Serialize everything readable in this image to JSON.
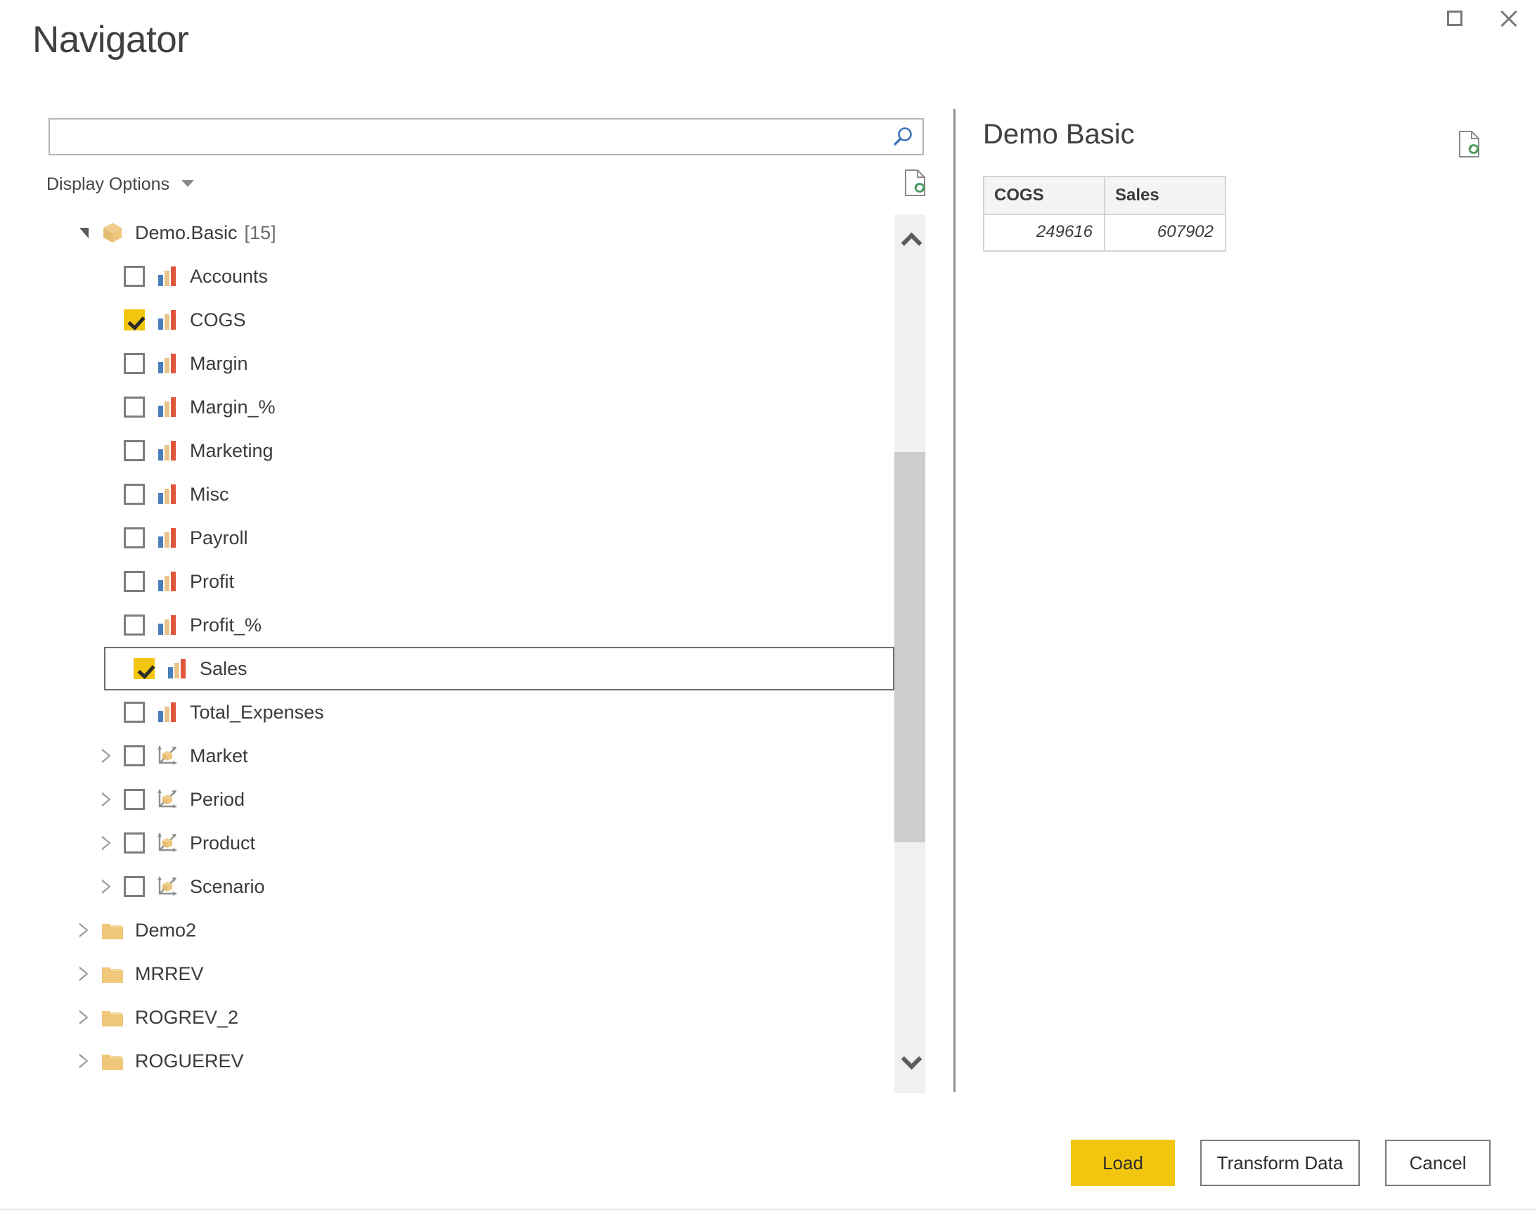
{
  "window": {
    "title": "Navigator",
    "controls": [
      {
        "name": "maximize",
        "icon": "maximize-icon"
      },
      {
        "name": "close",
        "icon": "close-icon"
      }
    ]
  },
  "search": {
    "value": "",
    "placeholder": "",
    "icon": "search-icon"
  },
  "toolbar": {
    "display_options_label": "Display Options",
    "refresh_icon": "refresh-preview-icon"
  },
  "tree": {
    "items": [
      {
        "label": "Demo.Basic",
        "count": "[15]",
        "icon": "cube-icon",
        "indent": 0,
        "expander": "expanded",
        "checkbox": "none",
        "selected": false
      },
      {
        "label": "Accounts",
        "count": "",
        "icon": "measure-bars-icon",
        "indent": 1,
        "expander": "none",
        "checkbox": "unchecked",
        "selected": false
      },
      {
        "label": "COGS",
        "count": "",
        "icon": "measure-bars-icon",
        "indent": 1,
        "expander": "none",
        "checkbox": "checked",
        "selected": false
      },
      {
        "label": "Margin",
        "count": "",
        "icon": "measure-bars-icon",
        "indent": 1,
        "expander": "none",
        "checkbox": "unchecked",
        "selected": false
      },
      {
        "label": "Margin_%",
        "count": "",
        "icon": "measure-bars-icon",
        "indent": 1,
        "expander": "none",
        "checkbox": "unchecked",
        "selected": false
      },
      {
        "label": "Marketing",
        "count": "",
        "icon": "measure-bars-icon",
        "indent": 1,
        "expander": "none",
        "checkbox": "unchecked",
        "selected": false
      },
      {
        "label": "Misc",
        "count": "",
        "icon": "measure-bars-icon",
        "indent": 1,
        "expander": "none",
        "checkbox": "unchecked",
        "selected": false
      },
      {
        "label": "Payroll",
        "count": "",
        "icon": "measure-bars-icon",
        "indent": 1,
        "expander": "none",
        "checkbox": "unchecked",
        "selected": false
      },
      {
        "label": "Profit",
        "count": "",
        "icon": "measure-bars-icon",
        "indent": 1,
        "expander": "none",
        "checkbox": "unchecked",
        "selected": false
      },
      {
        "label": "Profit_%",
        "count": "",
        "icon": "measure-bars-icon",
        "indent": 1,
        "expander": "none",
        "checkbox": "unchecked",
        "selected": false
      },
      {
        "label": "Sales",
        "count": "",
        "icon": "measure-bars-icon",
        "indent": 1,
        "expander": "none",
        "checkbox": "checked",
        "selected": true
      },
      {
        "label": "Total_Expenses",
        "count": "",
        "icon": "measure-bars-icon",
        "indent": 1,
        "expander": "none",
        "checkbox": "unchecked",
        "selected": false
      },
      {
        "label": "Market",
        "count": "",
        "icon": "dimension-axes-icon",
        "indent": 1,
        "expander": "collapsed",
        "checkbox": "unchecked",
        "selected": false
      },
      {
        "label": "Period",
        "count": "",
        "icon": "dimension-axes-icon",
        "indent": 1,
        "expander": "collapsed",
        "checkbox": "unchecked",
        "selected": false
      },
      {
        "label": "Product",
        "count": "",
        "icon": "dimension-axes-icon",
        "indent": 1,
        "expander": "collapsed",
        "checkbox": "unchecked",
        "selected": false
      },
      {
        "label": "Scenario",
        "count": "",
        "icon": "dimension-axes-icon",
        "indent": 1,
        "expander": "collapsed",
        "checkbox": "unchecked",
        "selected": false
      },
      {
        "label": "Demo2",
        "count": "",
        "icon": "folder-icon",
        "indent": 0,
        "expander": "collapsed",
        "checkbox": "none",
        "selected": false
      },
      {
        "label": "MRREV",
        "count": "",
        "icon": "folder-icon",
        "indent": 0,
        "expander": "collapsed",
        "checkbox": "none",
        "selected": false
      },
      {
        "label": "ROGREV_2",
        "count": "",
        "icon": "folder-icon",
        "indent": 0,
        "expander": "collapsed",
        "checkbox": "none",
        "selected": false
      },
      {
        "label": "ROGUEREV",
        "count": "",
        "icon": "folder-icon",
        "indent": 0,
        "expander": "collapsed",
        "checkbox": "none",
        "selected": false
      }
    ]
  },
  "scrollbar": {
    "up_icon": "chevron-up-icon",
    "down_icon": "chevron-down-icon"
  },
  "preview": {
    "title": "Demo Basic",
    "refresh_icon": "refresh-preview-icon",
    "columns": [
      "COGS",
      "Sales"
    ],
    "rows": [
      [
        "249616",
        "607902"
      ]
    ]
  },
  "footer": {
    "load_label": "Load",
    "transform_label": "Transform Data",
    "cancel_label": "Cancel"
  },
  "colors": {
    "accent_yellow": "#F2C60F",
    "folder_tan": "#EFC87C",
    "bar_blue": "#4A7EBB",
    "bar_tan": "#E8C48A",
    "bar_red": "#E0563C",
    "border_gray": "#7b7b7b",
    "scroll_thumb": "#cdcdcd"
  }
}
